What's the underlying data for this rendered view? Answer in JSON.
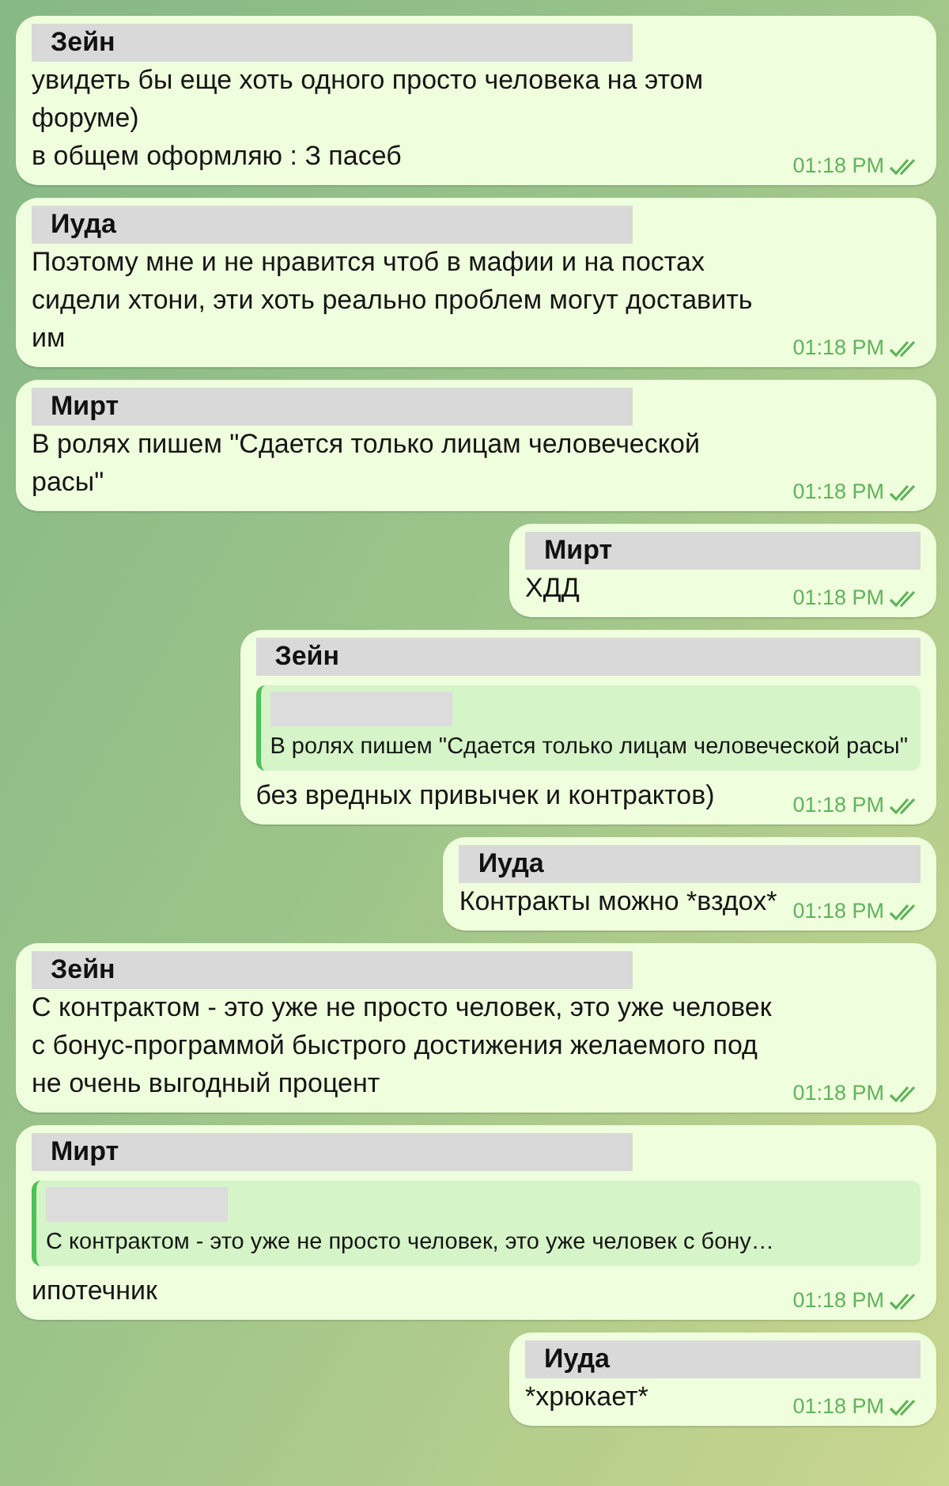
{
  "messages": [
    {
      "kind": "left",
      "sender": "Зейн",
      "text": "увидеть бы еще хоть одного просто человека на этом форуме)\nв общем оформляю : З пасеб",
      "time": "01:18 PM",
      "read": true
    },
    {
      "kind": "left",
      "sender": "Иуда",
      "text": "Поэтому мне и не нравится чтоб в мафии и на постах сидели хтони, эти хоть реально проблем могут доставить им",
      "time": "01:18 PM",
      "read": true
    },
    {
      "kind": "left",
      "sender": "Мирт",
      "text": "В ролях пишем \"Сдается только лицам человеческой расы\"",
      "time": "01:18 PM",
      "read": true
    },
    {
      "kind": "right",
      "sender": "Мирт",
      "text": "ХДД",
      "time": "01:18 PM",
      "read": true
    },
    {
      "kind": "right",
      "sender": "Зейн",
      "reply": {
        "text": "В ролях пишем \"Сдается только лицам человеческой расы\""
      },
      "text": "без вредных привычек и контрактов)",
      "time": "01:18 PM",
      "read": true
    },
    {
      "kind": "right",
      "sender": "Иуда",
      "text": "Контракты можно *вздох*",
      "time": "01:18 PM",
      "read": true
    },
    {
      "kind": "left",
      "sender": "Зейн",
      "text": "С контрактом - это уже не просто человек, это уже человек с бонус-программой быстрого достижения желаемого под не очень выгодный процент",
      "time": "01:18 PM",
      "read": true
    },
    {
      "kind": "left",
      "sender": "Мирт",
      "reply": {
        "text": "С контрактом - это уже не просто человек, это уже человек с бону…"
      },
      "text": "ипотечник",
      "time": "01:18 PM",
      "read": true
    },
    {
      "kind": "right",
      "sender": "Иуда",
      "text": "*хрюкает*",
      "time": "01:18 PM",
      "read": true
    }
  ]
}
